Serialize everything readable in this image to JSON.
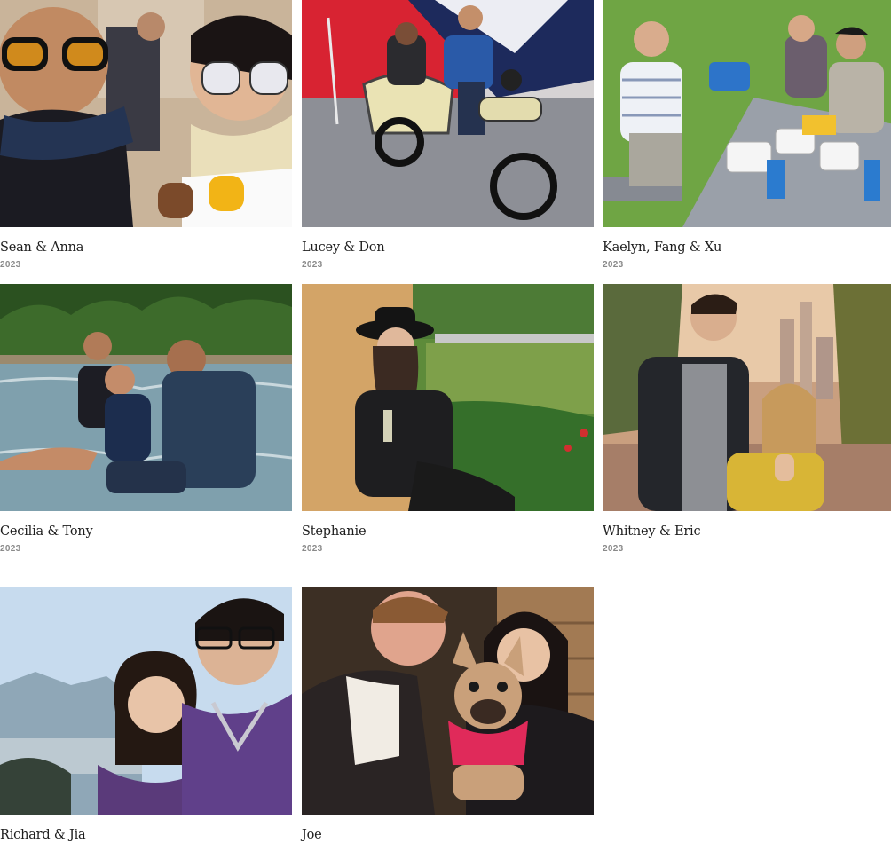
{
  "gallery": {
    "items": [
      {
        "title": "Sean & Anna",
        "year": "2023",
        "scene": "festival-selfie"
      },
      {
        "title": "Lucey & Don",
        "year": "2023",
        "scene": "motorcycle-sidecar"
      },
      {
        "title": "Kaelyn, Fang & Xu",
        "year": "2023",
        "scene": "park-picnic"
      },
      {
        "title": "Cecilia & Tony",
        "year": "2023",
        "scene": "river-sitting"
      },
      {
        "title": "Stephanie",
        "year": "2023",
        "scene": "vineyard-portrait"
      },
      {
        "title": "Whitney & Eric",
        "year": "2023",
        "scene": "sunset-city"
      },
      {
        "title": "Richard & Jia",
        "year": "",
        "scene": "lake-selfie"
      },
      {
        "title": "Joe",
        "year": "",
        "scene": "dog-selfie"
      }
    ]
  }
}
